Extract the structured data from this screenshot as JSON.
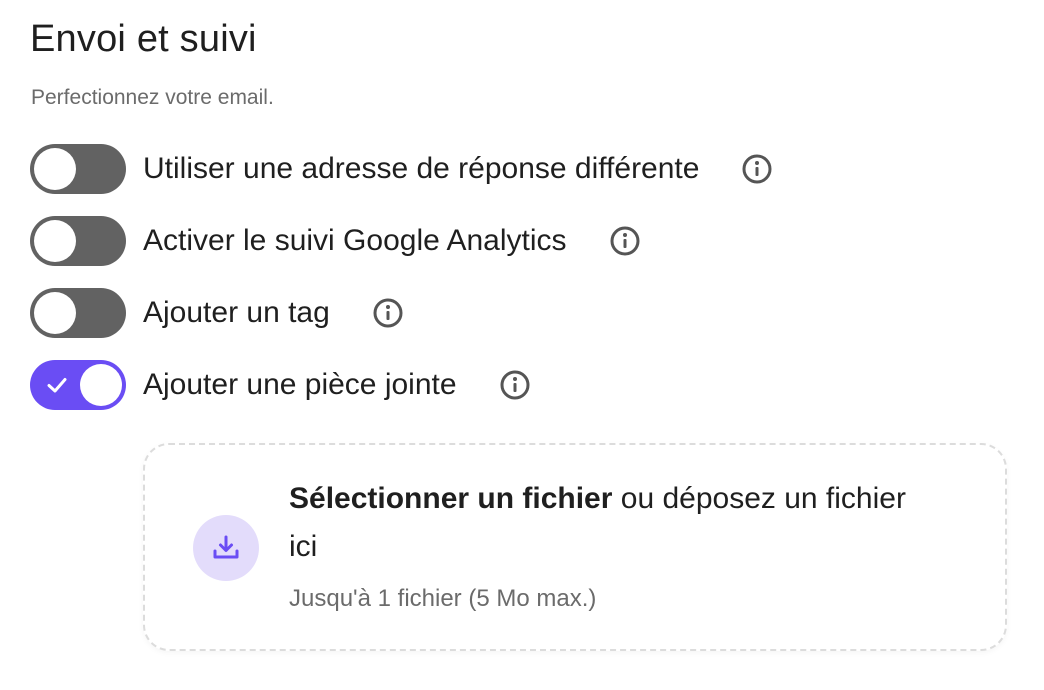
{
  "section": {
    "title": "Envoi et suivi",
    "subtitle": "Perfectionnez votre email."
  },
  "toggles": [
    {
      "label": "Utiliser une adresse de réponse différente",
      "enabled": false
    },
    {
      "label": "Activer le suivi Google Analytics",
      "enabled": false
    },
    {
      "label": "Ajouter un tag",
      "enabled": false
    },
    {
      "label": "Ajouter une pièce jointe",
      "enabled": true
    }
  ],
  "upload": {
    "select_label": "Sélectionner un fichier",
    "drop_label": " ou déposez un fichier ici",
    "hint": "Jusqu'à 1 fichier (5 Mo max.)"
  },
  "colors": {
    "toggle_on": "#6a4df4",
    "toggle_off": "#626262",
    "upload_icon_bg": "#e3dcfb",
    "upload_icon": "#6a4df4"
  },
  "icons": {
    "info": "info-icon",
    "check": "check-icon",
    "upload": "download-tray-icon"
  }
}
